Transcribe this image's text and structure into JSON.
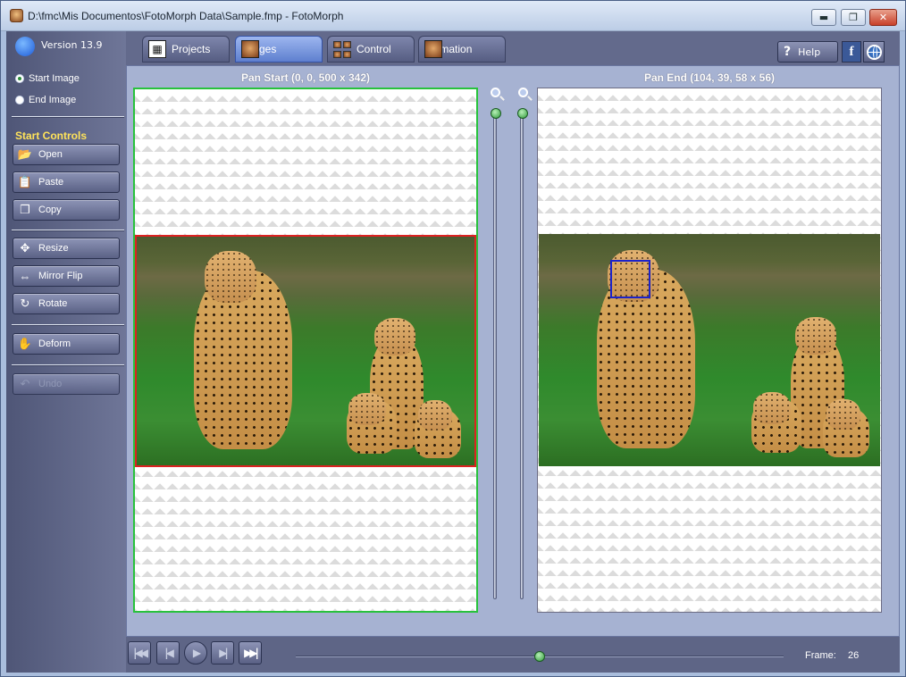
{
  "window": {
    "title": "D:\\fmc\\Mis Documentos\\FotoMorph Data\\Sample.fmp - FotoMorph",
    "min_label": "▬",
    "max_label": "❐",
    "close_label": "✕"
  },
  "sidebar": {
    "version": "Version 13.9",
    "radios": [
      {
        "label": "Start Image",
        "selected": true
      },
      {
        "label": "End Image",
        "selected": false
      }
    ],
    "section_label": "Start Controls",
    "buttons": [
      {
        "label": "Open",
        "icon": "folder-open-icon"
      },
      {
        "label": "Paste",
        "icon": "paste-icon"
      },
      {
        "label": "Copy",
        "icon": "copy-icon"
      },
      {
        "label": "Resize",
        "icon": "move-arrows-icon"
      },
      {
        "label": "Mirror Flip",
        "icon": "mirror-flip-icon"
      },
      {
        "label": "Rotate",
        "icon": "rotate-icon"
      },
      {
        "label": "Deform",
        "icon": "deform-icon"
      },
      {
        "label": "Undo",
        "icon": "undo-icon",
        "disabled": true
      }
    ]
  },
  "tabs": [
    {
      "label": "Projects",
      "active": false
    },
    {
      "label": "Images",
      "active": true
    },
    {
      "label": "Control",
      "active": false
    },
    {
      "label": "Animation",
      "active": false
    }
  ],
  "toolbar": {
    "help_label": "Help",
    "facebook_label": "f"
  },
  "panels": {
    "left_title": "Pan Start (0, 0, 500 x 342)",
    "right_title": "Pan End (104, 39, 58 x 56)"
  },
  "playback": {
    "frame_label": "Frame:",
    "frame_value": "26",
    "timeline_position": 0.5
  },
  "colors": {
    "start_border": "#28c23c",
    "selection_red": "#d22222",
    "selection_blue": "#1c23c9",
    "section_label": "#ffe35a"
  }
}
